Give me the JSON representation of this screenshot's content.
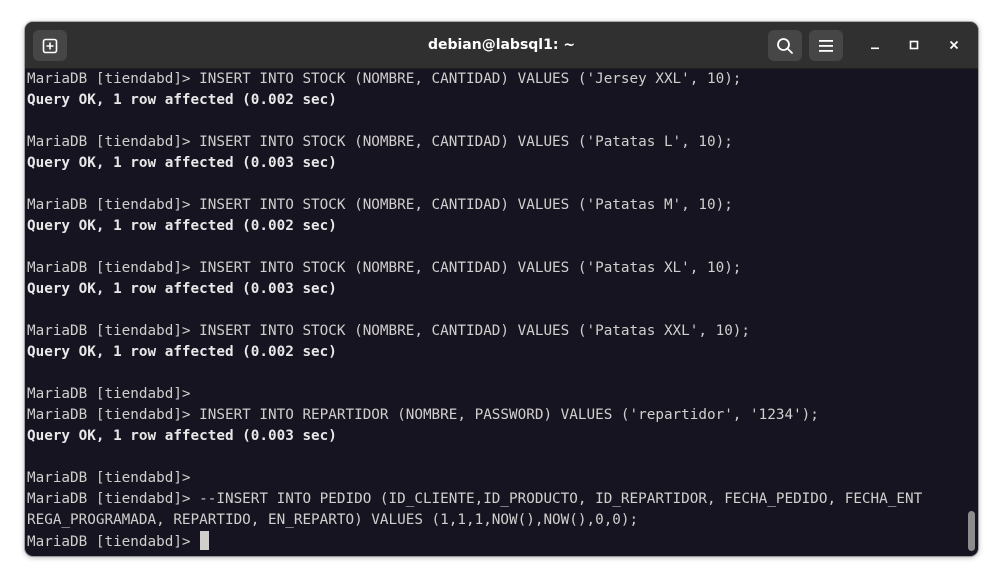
{
  "window": {
    "title": "debian@labsql1: ~"
  },
  "toolbar": {
    "new_tab_icon": "new-tab-icon",
    "search_icon": "search-icon",
    "menu_icon": "hamburger-menu-icon",
    "minimize_icon": "minimize-icon",
    "maximize_icon": "maximize-icon",
    "close_icon": "close-icon"
  },
  "terminal": {
    "lines": [
      "MariaDB [tiendabd]> INSERT INTO STOCK (NOMBRE, CANTIDAD) VALUES ('Jersey XXL', 10);",
      "Query OK, 1 row affected (0.002 sec)",
      "",
      "MariaDB [tiendabd]> INSERT INTO STOCK (NOMBRE, CANTIDAD) VALUES ('Patatas L', 10);",
      "Query OK, 1 row affected (0.003 sec)",
      "",
      "MariaDB [tiendabd]> INSERT INTO STOCK (NOMBRE, CANTIDAD) VALUES ('Patatas M', 10);",
      "Query OK, 1 row affected (0.002 sec)",
      "",
      "MariaDB [tiendabd]> INSERT INTO STOCK (NOMBRE, CANTIDAD) VALUES ('Patatas XL', 10);",
      "Query OK, 1 row affected (0.003 sec)",
      "",
      "MariaDB [tiendabd]> INSERT INTO STOCK (NOMBRE, CANTIDAD) VALUES ('Patatas XXL', 10);",
      "Query OK, 1 row affected (0.002 sec)",
      "",
      "MariaDB [tiendabd]>",
      "MariaDB [tiendabd]> INSERT INTO REPARTIDOR (NOMBRE, PASSWORD) VALUES ('repartidor', '1234');",
      "Query OK, 1 row affected (0.003 sec)",
      "",
      "MariaDB [tiendabd]>",
      "MariaDB [tiendabd]> --INSERT INTO PEDIDO (ID_CLIENTE,ID_PRODUCTO, ID_REPARTIDOR, FECHA_PEDIDO, FECHA_ENT",
      "REGA_PROGRAMADA, REPARTIDO, EN_REPARTO) VALUES (1,1,1,NOW(),NOW(),0,0);"
    ],
    "prompt": "MariaDB [tiendabd]> "
  },
  "colors": {
    "terminal_bg": "#171421",
    "terminal_fg": "#d0cfcc",
    "titlebar_bg": "#303030",
    "button_bg": "#464646"
  }
}
